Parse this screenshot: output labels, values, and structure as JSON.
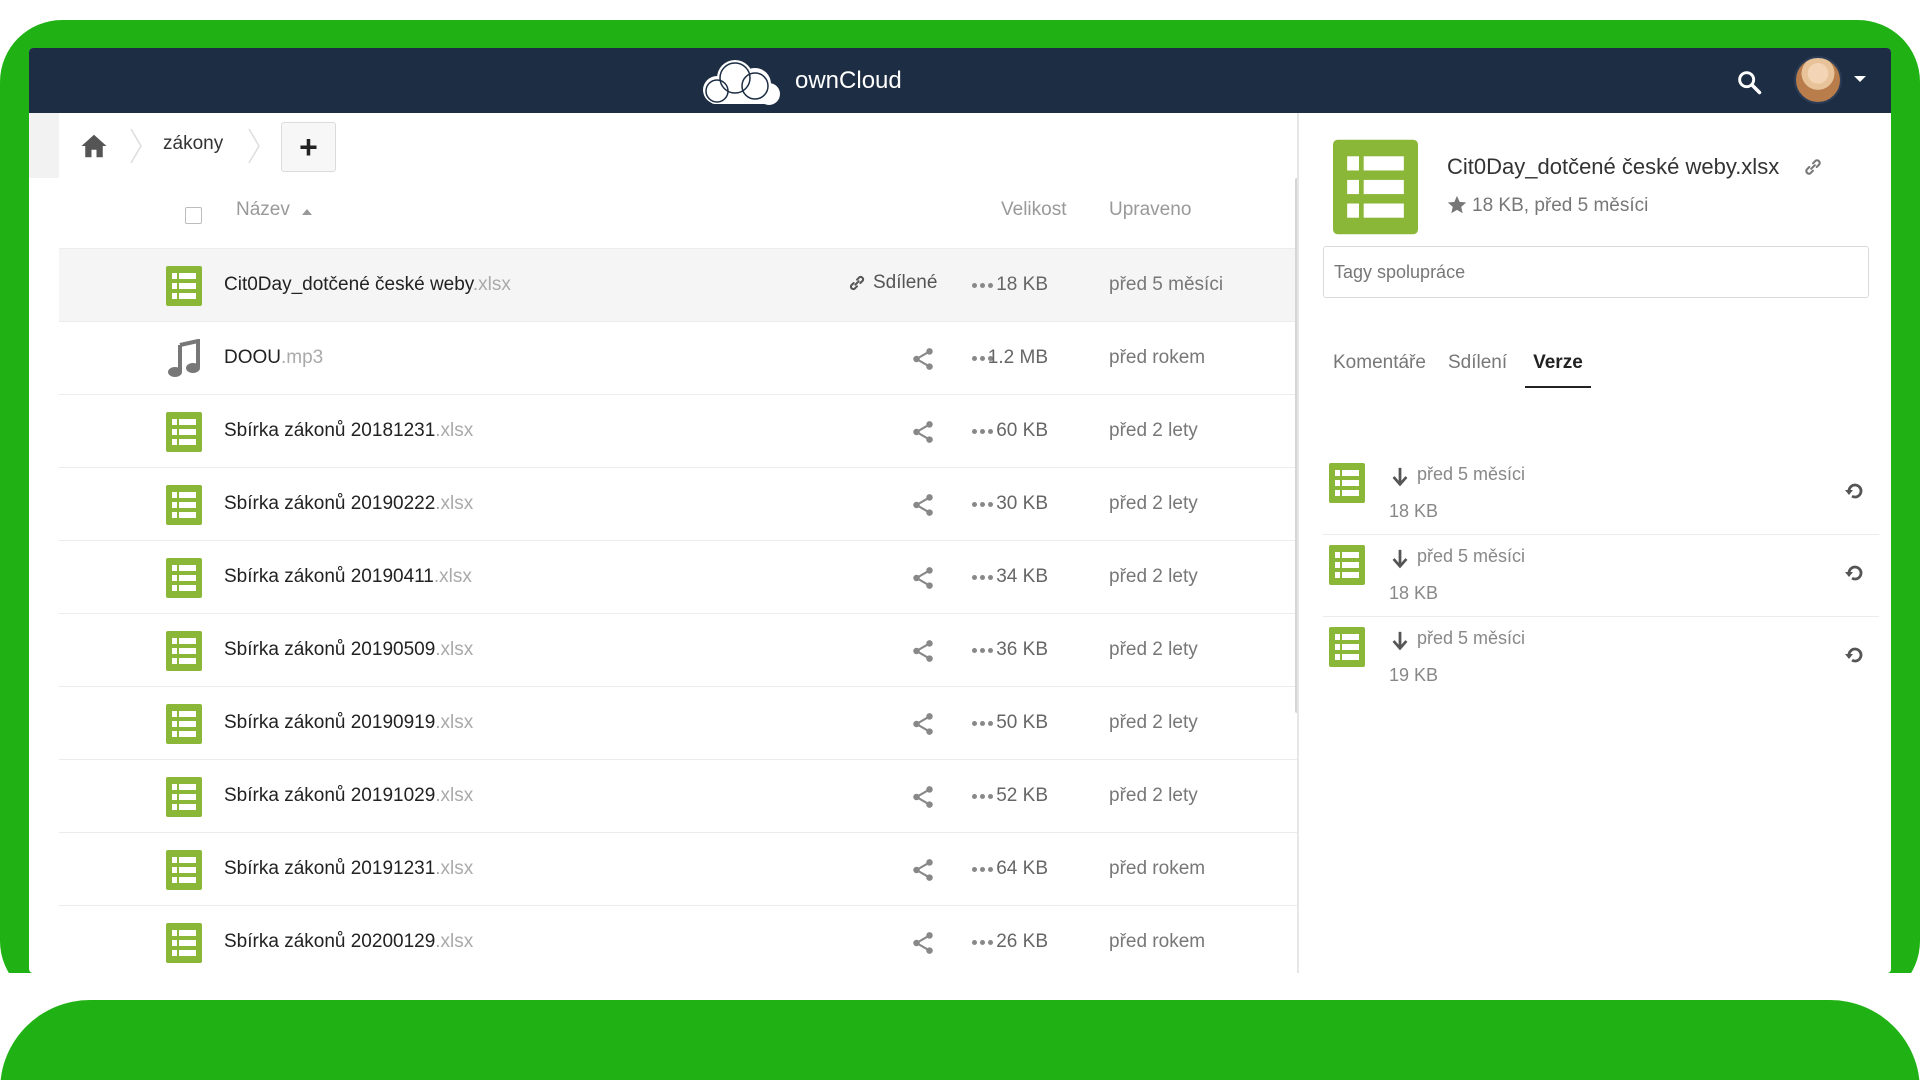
{
  "app": {
    "name": "ownCloud"
  },
  "colors": {
    "frame_green": "#20b214",
    "header_bg": "#1d2d44",
    "spreadsheet_green": "#8bb738"
  },
  "breadcrumb": {
    "folder": "zákony",
    "new_button": "+"
  },
  "file_list": {
    "columns": {
      "name": "Název",
      "size": "Velikost",
      "modified": "Upraveno"
    },
    "shared_label": "Sdílené",
    "rows": [
      {
        "name": "Cit0Day_dotčené české weby",
        "ext": ".xlsx",
        "type": "spreadsheet",
        "size": "18 KB",
        "modified": "před 5 měsíci"
      },
      {
        "name": "DOOU",
        "ext": ".mp3",
        "type": "audio",
        "size": "1.2 MB",
        "modified": "před rokem"
      },
      {
        "name": "Sbírka zákonů 20181231",
        "ext": ".xlsx",
        "type": "spreadsheet",
        "size": "60 KB",
        "modified": "před 2 lety"
      },
      {
        "name": "Sbírka zákonů 20190222",
        "ext": ".xlsx",
        "type": "spreadsheet",
        "size": "30 KB",
        "modified": "před 2 lety"
      },
      {
        "name": "Sbírka zákonů 20190411",
        "ext": ".xlsx",
        "type": "spreadsheet",
        "size": "34 KB",
        "modified": "před 2 lety"
      },
      {
        "name": "Sbírka zákonů 20190509",
        "ext": ".xlsx",
        "type": "spreadsheet",
        "size": "36 KB",
        "modified": "před 2 lety"
      },
      {
        "name": "Sbírka zákonů 20190919",
        "ext": ".xlsx",
        "type": "spreadsheet",
        "size": "50 KB",
        "modified": "před 2 lety"
      },
      {
        "name": "Sbírka zákonů 20191029",
        "ext": ".xlsx",
        "type": "spreadsheet",
        "size": "52 KB",
        "modified": "před 2 lety"
      },
      {
        "name": "Sbírka zákonů 20191231",
        "ext": ".xlsx",
        "type": "spreadsheet",
        "size": "64 KB",
        "modified": "před rokem"
      },
      {
        "name": "Sbírka zákonů 20200129",
        "ext": ".xlsx",
        "type": "spreadsheet",
        "size": "26 KB",
        "modified": "před rokem"
      }
    ]
  },
  "sidebar": {
    "title": "Cit0Day_dotčené české weby.xlsx",
    "meta": "18 KB, před 5 měsíci",
    "tags_placeholder": "Tagy spolupráce",
    "tabs": [
      {
        "label": "Komentáře"
      },
      {
        "label": "Sdílení"
      },
      {
        "label": "Verze"
      }
    ],
    "versions": [
      {
        "time": "před 5 měsíci",
        "size": "18 KB"
      },
      {
        "time": "před 5 měsíci",
        "size": "18 KB"
      },
      {
        "time": "před 5 měsíci",
        "size": "19 KB"
      }
    ]
  }
}
